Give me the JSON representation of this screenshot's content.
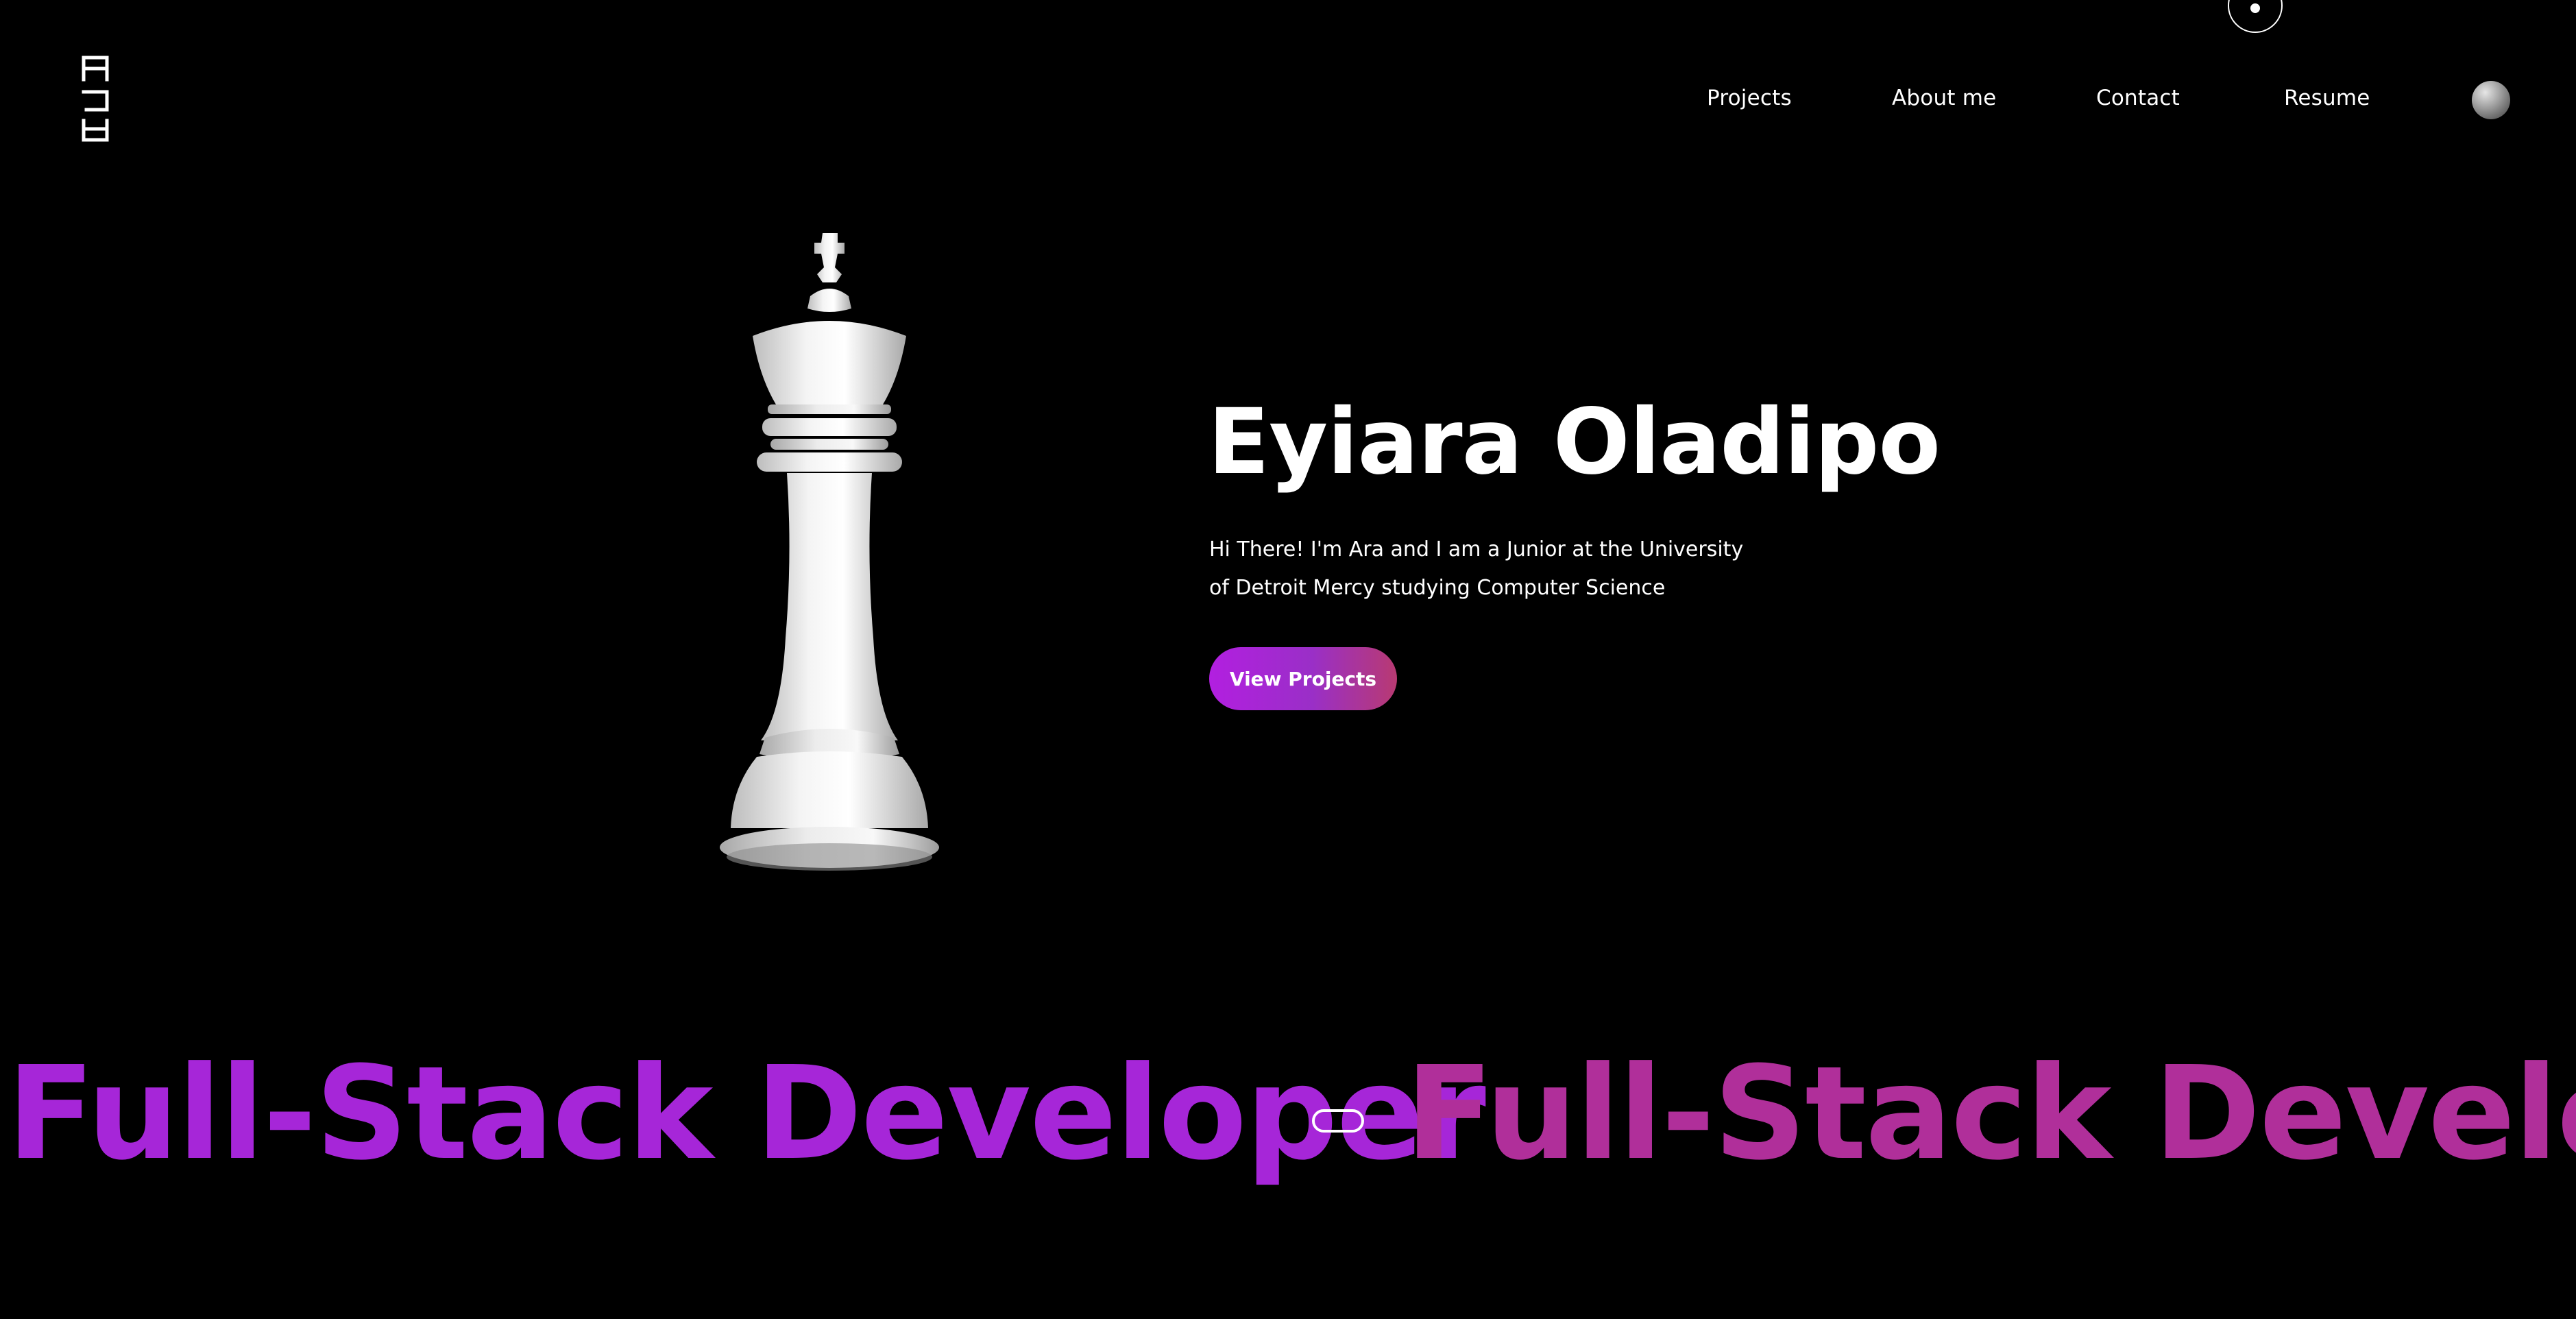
{
  "logo": {
    "icon": "ara-monogram-logo"
  },
  "nav": {
    "items": [
      {
        "label": "Projects"
      },
      {
        "label": "About me"
      },
      {
        "label": "Contact"
      },
      {
        "label": "Resume"
      }
    ],
    "theme_toggle_icon": "theme-toggle-orb-icon"
  },
  "hero": {
    "image_icon": "chess-king-icon",
    "title": "Eyiara Oladipo",
    "description": "Hi There! I'm Ara and I am a Junior at the University of Detroit Mercy studying Computer Science",
    "button_label": "View Projects"
  },
  "marquee": {
    "text_1": "Full-Stack Developer",
    "text_2": "Full-Stack Develope"
  },
  "colors": {
    "background": "#000000",
    "accent_purple": "#a626d8",
    "accent_pink": "#b83a72"
  }
}
